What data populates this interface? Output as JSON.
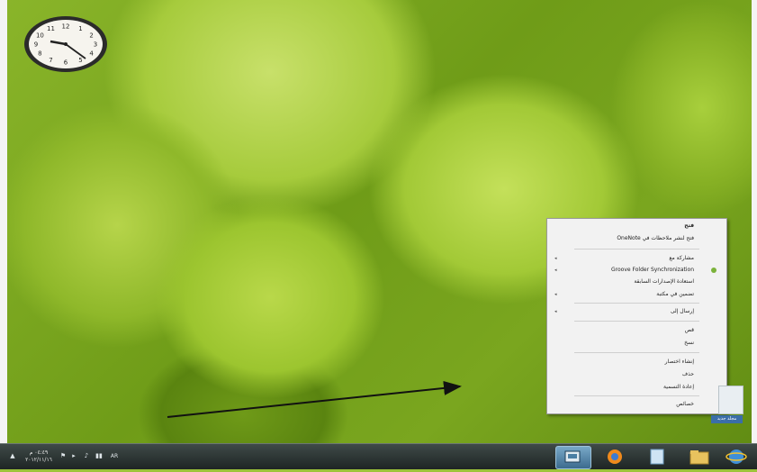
{
  "clock_gadget": {
    "numerals": [
      "12",
      "1",
      "2",
      "3",
      "4",
      "5",
      "6",
      "7",
      "8",
      "9",
      "10",
      "11"
    ]
  },
  "context_menu": {
    "items": [
      {
        "label": "فتح",
        "bold": true,
        "submenu": false
      },
      {
        "label": "فتح لنشر ملاحظات في OneNote",
        "bold": false,
        "submenu": false
      },
      {
        "label": "مشاركة مع",
        "bold": false,
        "submenu": true
      },
      {
        "label": "Groove Folder Synchronization",
        "bold": false,
        "submenu": true,
        "icon": "groove-icon"
      },
      {
        "label": "استعادة الإصدارات السابقة",
        "bold": false,
        "submenu": false
      },
      {
        "label": "تضمين في مكتبة",
        "bold": false,
        "submenu": true
      },
      {
        "label": "إرسال إلى",
        "bold": false,
        "submenu": true
      },
      {
        "label": "قص",
        "bold": false,
        "submenu": false
      },
      {
        "label": "نسخ",
        "bold": false,
        "submenu": false
      },
      {
        "label": "إنشاء اختصار",
        "bold": false,
        "submenu": false
      },
      {
        "label": "حذف",
        "bold": false,
        "submenu": false
      },
      {
        "label": "إعادة التسمية",
        "bold": false,
        "submenu": false
      },
      {
        "label": "خصائص",
        "bold": false,
        "submenu": false
      }
    ]
  },
  "desktop_file": {
    "label": "مجلد جديد"
  },
  "taskbar": {
    "tray_time": "٠٤:٤٩ م",
    "tray_date": "٢٠١٢/١١/١٦",
    "language": "AR",
    "accent_color": "#3c6b8e"
  }
}
